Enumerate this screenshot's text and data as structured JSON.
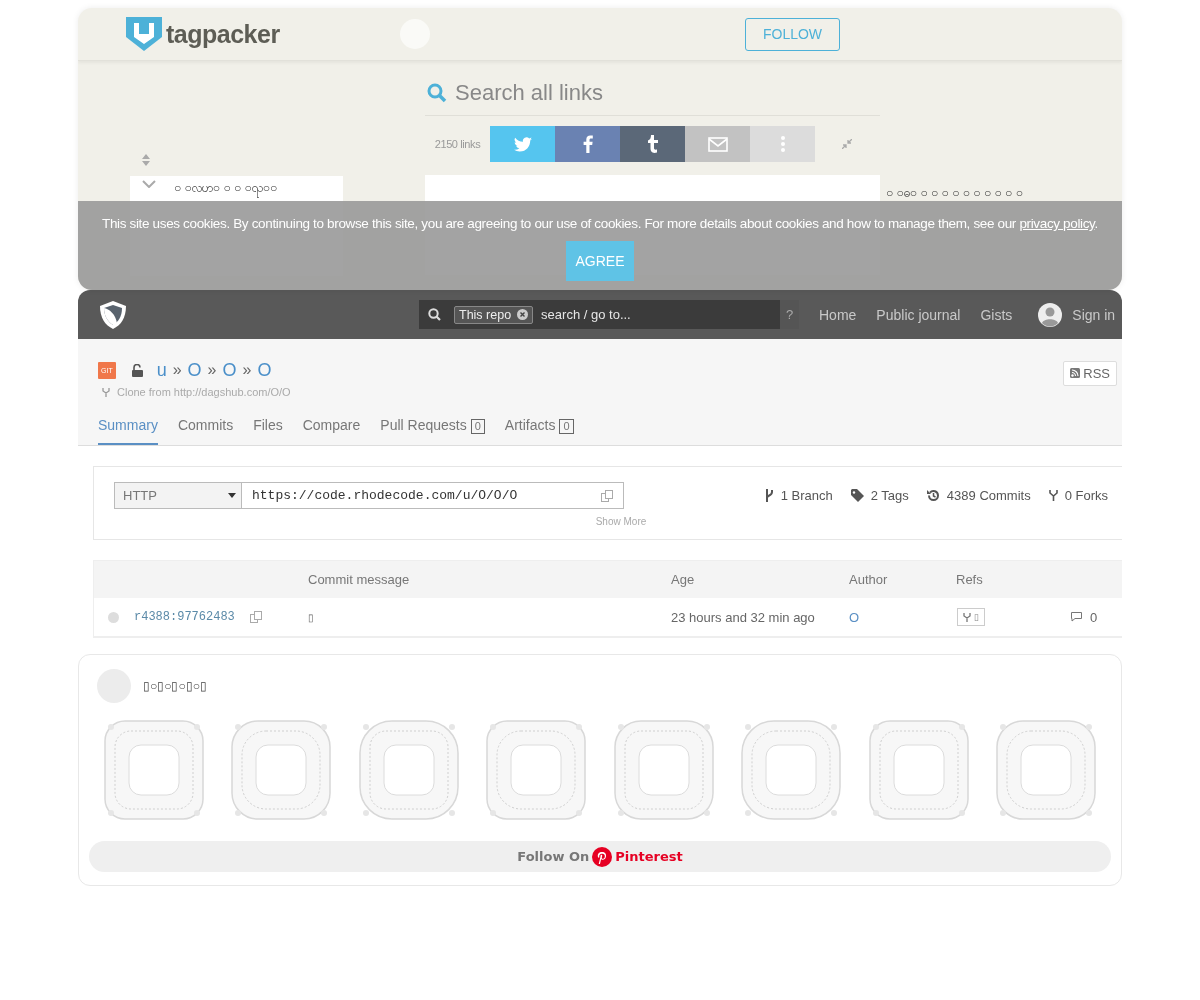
{
  "tagpacker": {
    "logo": "tagpacker",
    "follow_button": "FOLLOW",
    "search": {
      "placeholder": "Search all links"
    },
    "link_count": "2150 links",
    "share_buttons": [
      {
        "kind": "twitter"
      },
      {
        "kind": "facebook"
      },
      {
        "kind": "tumblr"
      },
      {
        "kind": "email"
      },
      {
        "kind": "more"
      }
    ],
    "tag_row_left": "○ ○လဟ○ ○ ○ ○ၺ○○",
    "tag_row_right": "○ ○ဓ○ ○ ○ ○ ○ ○ ○ ○ ○ ○ ○"
  },
  "cookie_banner": {
    "text": "This site uses cookies. By continuing to browse this site, you are agreeing to our use of cookies. For more details about cookies and how to manage them, see our ",
    "link": "privacy policy",
    "end": ".",
    "button": "AGREE"
  },
  "rhodecode": {
    "search": {
      "scope": "This repo",
      "placeholder": "search / go to...",
      "help": "?"
    },
    "nav": [
      "Home",
      "Public journal",
      "Gists"
    ],
    "sign_in": "Sign in",
    "repo": {
      "badge": "GIT",
      "path": [
        "u",
        "O",
        "O",
        "O"
      ],
      "separator": "»",
      "clone_from": "Clone from http://dagshub.com/O/O",
      "rss": "RSS"
    },
    "tabs": [
      {
        "label": "Summary",
        "selected": true
      },
      {
        "label": "Commits",
        "selected": false
      },
      {
        "label": "Files",
        "selected": false
      },
      {
        "label": "Compare",
        "selected": false
      },
      {
        "label": "Pull Requests",
        "count": "0",
        "selected": false
      },
      {
        "label": "Artifacts",
        "count": "0",
        "selected": false
      }
    ],
    "clone": {
      "protocol": "HTTP",
      "url": "https://code.rhodecode.com/u/O/O/O"
    },
    "stats": [
      {
        "kind": "branch",
        "text": "1 Branch"
      },
      {
        "kind": "tag",
        "text": "2 Tags"
      },
      {
        "kind": "commits",
        "text": "4389 Commits"
      },
      {
        "kind": "forks",
        "text": "0 Forks"
      }
    ],
    "show_more": "Show More",
    "table": {
      "columns": [
        "Commit message",
        "Age",
        "Author",
        "Refs"
      ],
      "rows": [
        {
          "commit": "r4388:97762483",
          "message": "▯",
          "age": "23 hours and 32 min ago",
          "author": "O",
          "ref": "▯",
          "comments": "0"
        }
      ]
    }
  },
  "pinterest": {
    "title": "▯○▯○▯○▯○▯",
    "follow_label": "Follow On",
    "brand": "Pinterest"
  }
}
